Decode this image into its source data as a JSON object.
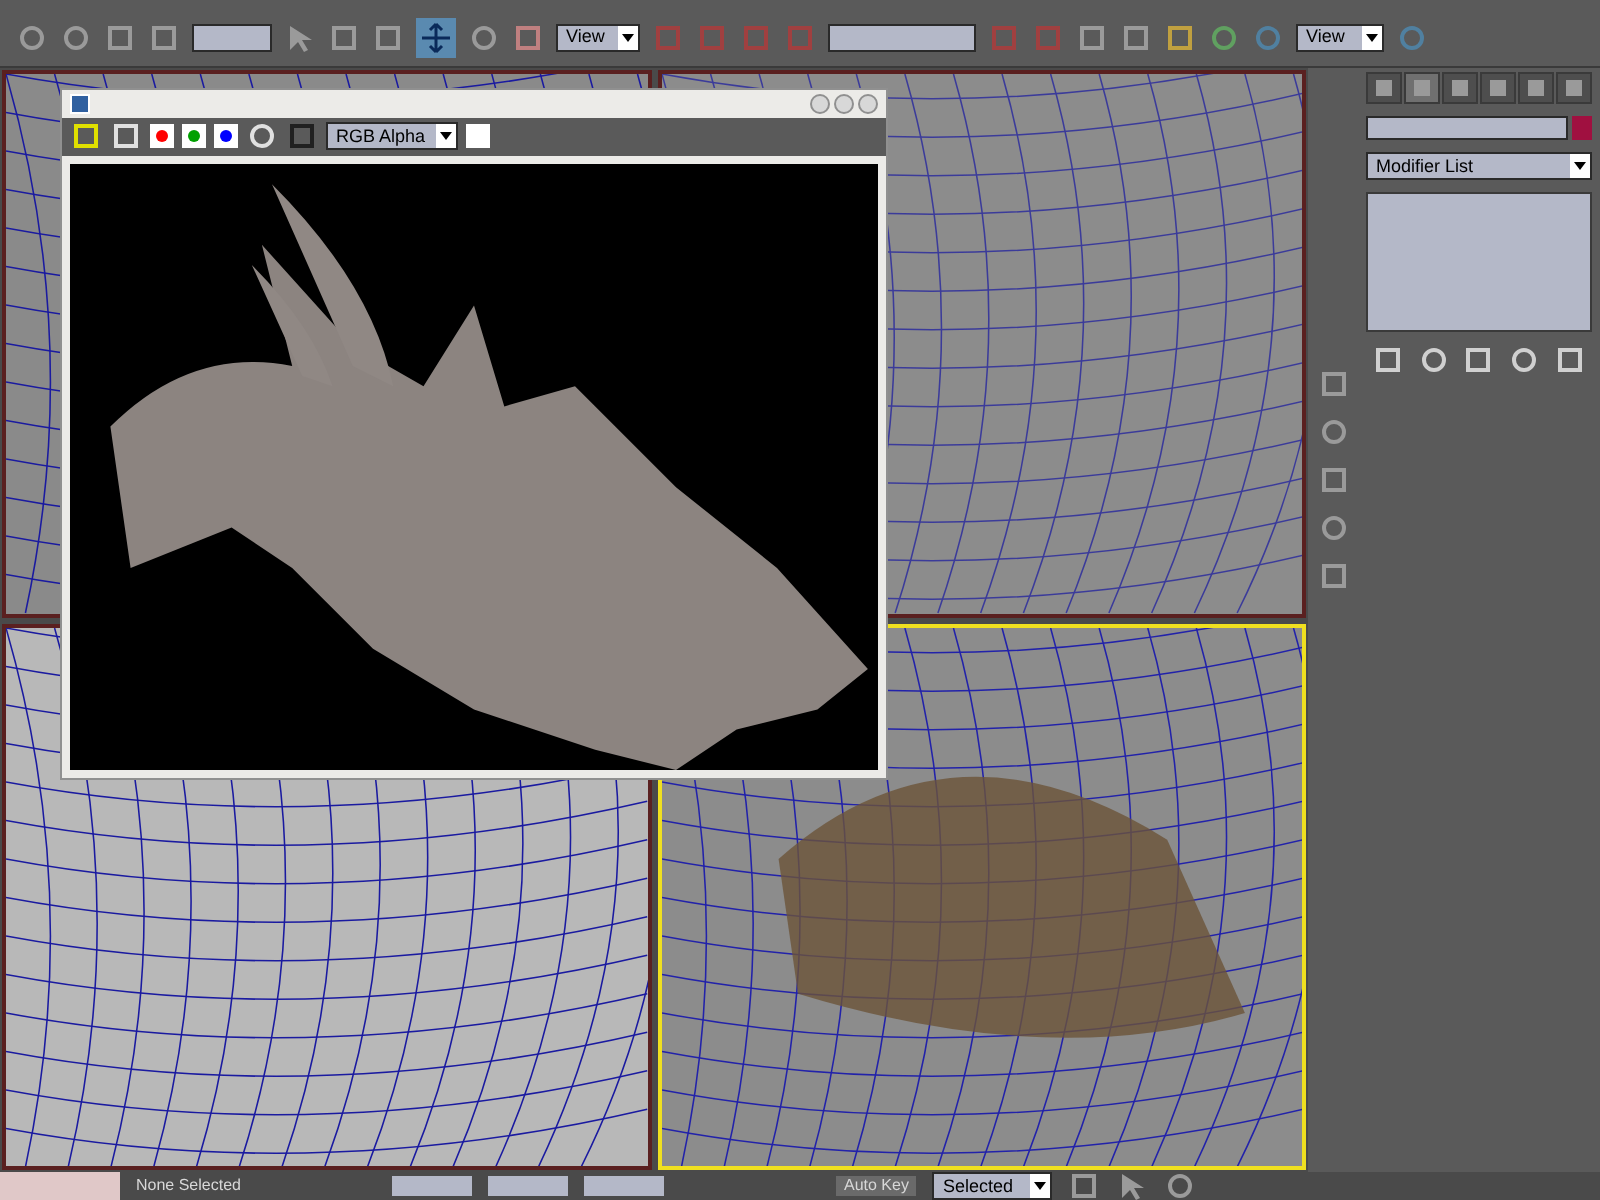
{
  "toolbar": {
    "reference_dropdown": "View",
    "render_dropdown": "View"
  },
  "viewports": [
    {
      "selected": false
    },
    {
      "selected": false
    },
    {
      "selected": false
    },
    {
      "selected": true
    }
  ],
  "render_window": {
    "channel_dropdown": "RGB Alpha",
    "channels": [
      {
        "color": "#ff0000",
        "on": true
      },
      {
        "color": "#00a000",
        "on": true
      },
      {
        "color": "#0000ff",
        "on": true
      }
    ]
  },
  "command_panel": {
    "tabs": [
      {
        "selected": false
      },
      {
        "selected": true
      },
      {
        "selected": false
      },
      {
        "selected": false
      },
      {
        "selected": false
      },
      {
        "selected": false
      }
    ],
    "modifier_list": "Modifier List"
  },
  "status_bar": {
    "selection": "None Selected",
    "auto_key": "Auto Key",
    "key_filter": "Selected"
  }
}
